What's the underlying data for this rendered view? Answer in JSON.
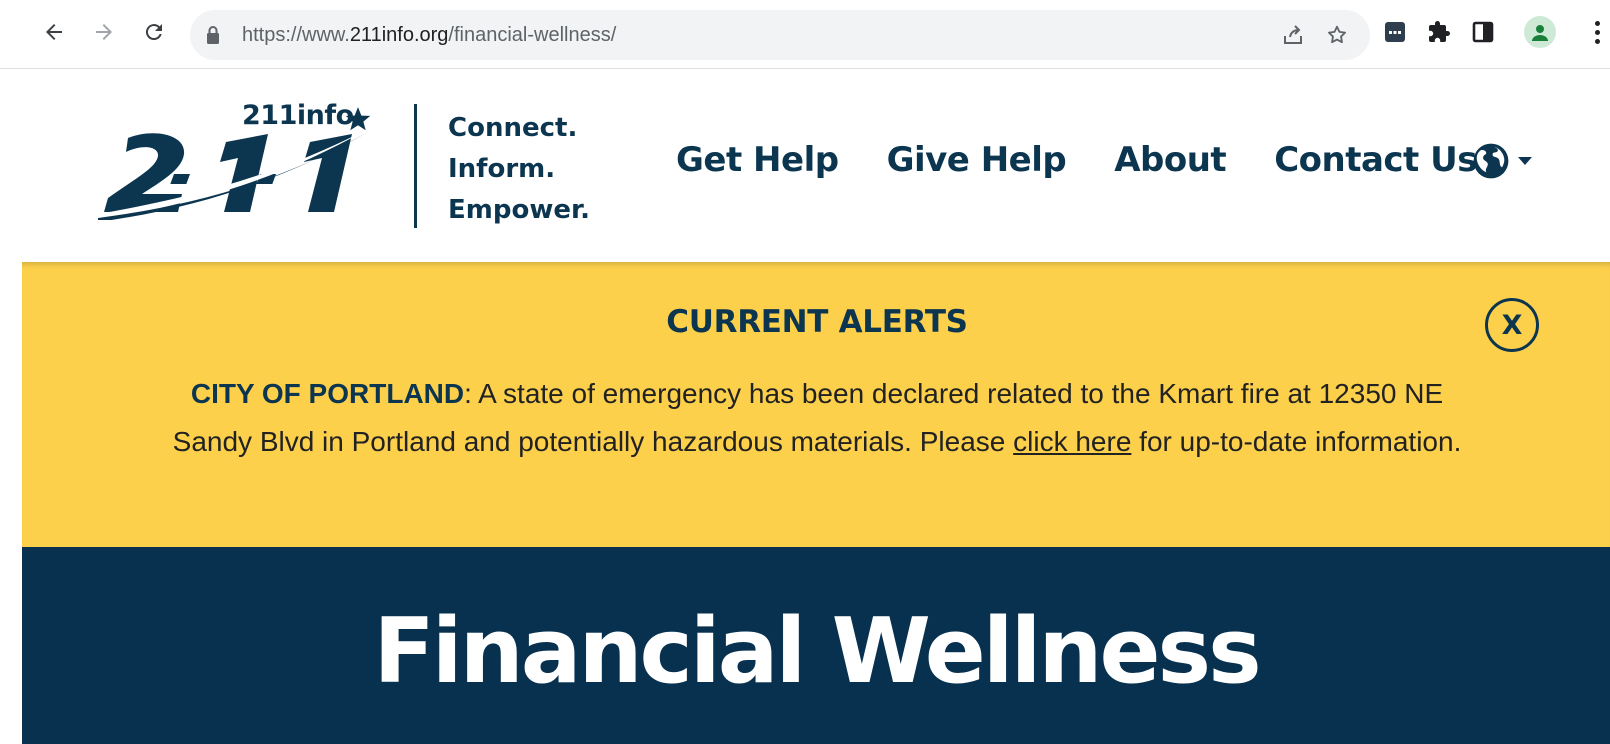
{
  "browser": {
    "url_scheme": "https://www.",
    "url_host": "211info.org",
    "url_path": "/financial-wellness/",
    "icons": [
      "back-arrow-icon",
      "forward-arrow-icon",
      "reload-icon",
      "lock-icon",
      "share-icon",
      "star-icon",
      "extension-icon",
      "puzzle-icon",
      "side-panel-icon",
      "profile-icon",
      "menu-dots-icon"
    ]
  },
  "header": {
    "logo_small_text": "211info",
    "tagline": [
      "Connect.",
      "Inform.",
      "Empower."
    ],
    "nav": [
      "Get Help",
      "Give Help",
      "About",
      "Contact Us"
    ],
    "language_icon": "globe-icon"
  },
  "alert": {
    "title": "CURRENT ALERTS",
    "close_label": "X",
    "strong_prefix": "CITY OF PORTLAND",
    "text_before_link": ": A state of emergency has been declared related to the Kmart fire at 12350 NE Sandy Blvd in Portland and potentially hazardous materials. Please ",
    "link_text": "click here",
    "text_after_link": " for up-to-date information."
  },
  "hero": {
    "title": "Financial Wellness"
  },
  "colors": {
    "navy": "#0c3550",
    "alert_yellow": "#fdd04b",
    "hero_bg": "#07314f"
  }
}
